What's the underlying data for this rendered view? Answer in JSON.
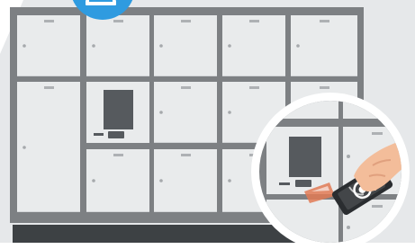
{
  "scene": {
    "subject": "locker-bank-with-card-reader",
    "colors": {
      "background": "#e6e8ea",
      "frame": "#7d8083",
      "door": "#e9ebec",
      "door_edge": "#d3d6d8",
      "handle": "#aeb1b4",
      "knob": "#a6a9ac",
      "panel_screen": "#565a5e",
      "base": "#3d4144",
      "floor": "#ffffff",
      "badge": "#2f9be0",
      "badge_icon": "#ffffff",
      "zoom_ring": "#ffffff",
      "skin": "#f3bd9a",
      "skin_shade": "#e0a07e",
      "phone": "#2a2d30",
      "nfc_waves": "#e07a55"
    },
    "icons": [
      "tablet-icon",
      "hand-icon",
      "phone-icon",
      "nfc-waves-icon",
      "keypad-icon"
    ]
  }
}
